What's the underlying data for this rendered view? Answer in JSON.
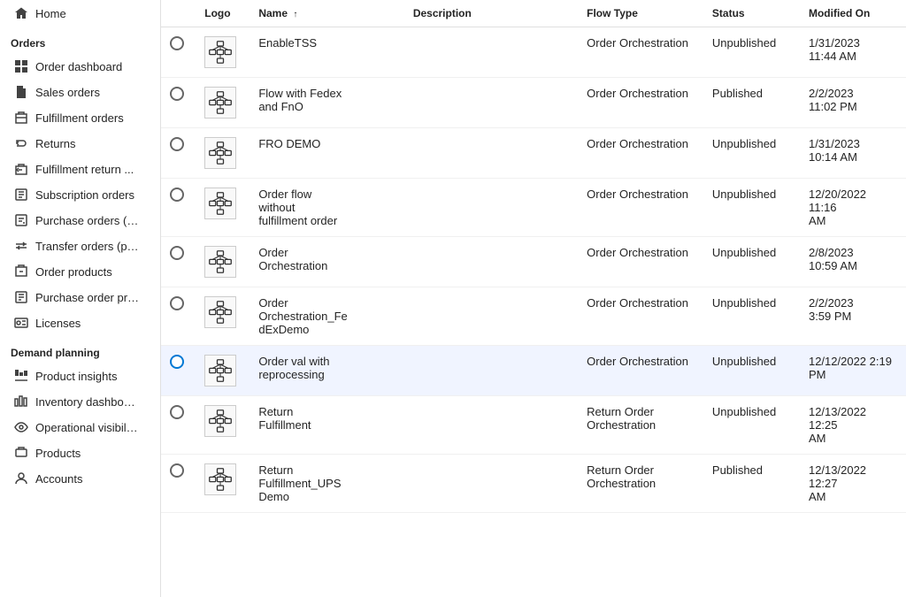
{
  "sidebar": {
    "home_label": "Home",
    "sections": [
      {
        "id": "orders",
        "header": "Orders",
        "items": [
          {
            "id": "order-dashboard",
            "label": "Order dashboard",
            "icon": "grid"
          },
          {
            "id": "sales-orders",
            "label": "Sales orders",
            "icon": "doc"
          },
          {
            "id": "fulfillment-orders",
            "label": "Fulfillment orders",
            "icon": "box"
          },
          {
            "id": "returns",
            "label": "Returns",
            "icon": "return"
          },
          {
            "id": "fulfillment-return",
            "label": "Fulfillment return ...",
            "icon": "return-box"
          },
          {
            "id": "subscription-orders",
            "label": "Subscription orders",
            "icon": "sub"
          },
          {
            "id": "purchase-orders",
            "label": "Purchase orders (…",
            "icon": "purchase"
          },
          {
            "id": "transfer-orders",
            "label": "Transfer orders (p…",
            "icon": "transfer"
          },
          {
            "id": "order-products",
            "label": "Order products",
            "icon": "order-prod"
          },
          {
            "id": "purchase-order-pr",
            "label": "Purchase order pr…",
            "icon": "po-pr"
          },
          {
            "id": "licenses",
            "label": "Licenses",
            "icon": "license"
          }
        ]
      },
      {
        "id": "demand-planning",
        "header": "Demand planning",
        "items": [
          {
            "id": "product-insights",
            "label": "Product insights",
            "icon": "chart"
          },
          {
            "id": "inventory-dashbo",
            "label": "Inventory dashbo…",
            "icon": "chart2"
          },
          {
            "id": "operational-visib",
            "label": "Operational visibil…",
            "icon": "eye"
          },
          {
            "id": "products",
            "label": "Products",
            "icon": "product"
          },
          {
            "id": "accounts",
            "label": "Accounts",
            "icon": "account"
          }
        ]
      }
    ]
  },
  "table": {
    "columns": [
      {
        "id": "radio",
        "label": ""
      },
      {
        "id": "logo",
        "label": "Logo"
      },
      {
        "id": "name",
        "label": "Name",
        "sortable": true,
        "sort": "asc"
      },
      {
        "id": "description",
        "label": "Description"
      },
      {
        "id": "flow_type",
        "label": "Flow Type"
      },
      {
        "id": "status",
        "label": "Status"
      },
      {
        "id": "modified_on",
        "label": "Modified On"
      }
    ],
    "rows": [
      {
        "id": 1,
        "name": "EnableTSS",
        "description": "",
        "flow_type": "Order Orchestration",
        "status": "Unpublished",
        "modified_on": "1/31/2023\n11:44 AM",
        "selected": false
      },
      {
        "id": 2,
        "name": "Flow with Fedex\nand FnO",
        "description": "",
        "flow_type": "Order Orchestration",
        "status": "Published",
        "modified_on": "2/2/2023\n11:02 PM",
        "selected": false
      },
      {
        "id": 3,
        "name": "FRO DEMO",
        "description": "",
        "flow_type": "Order Orchestration",
        "status": "Unpublished",
        "modified_on": "1/31/2023\n10:14 AM",
        "selected": false
      },
      {
        "id": 4,
        "name": "Order flow\nwithout\nfulfillment order",
        "description": "",
        "flow_type": "Order Orchestration",
        "status": "Unpublished",
        "modified_on": "12/20/2022 11:16\nAM",
        "selected": false
      },
      {
        "id": 5,
        "name": "Order\nOrchestration",
        "description": "",
        "flow_type": "Order Orchestration",
        "status": "Unpublished",
        "modified_on": "2/8/2023\n10:59 AM",
        "selected": false
      },
      {
        "id": 6,
        "name": "Order\nOrchestration_Fe\ndExDemo",
        "description": "",
        "flow_type": "Order Orchestration",
        "status": "Unpublished",
        "modified_on": "2/2/2023\n3:59 PM",
        "selected": false
      },
      {
        "id": 7,
        "name": "Order val with\nreprocessing",
        "description": "",
        "flow_type": "Order Orchestration",
        "status": "Unpublished",
        "modified_on": "12/12/2022 2:19 PM",
        "selected": true
      },
      {
        "id": 8,
        "name": "Return\nFulfillment",
        "description": "",
        "flow_type": "Return Order Orchestration",
        "status": "Unpublished",
        "modified_on": "12/13/2022 12:25\nAM",
        "selected": false
      },
      {
        "id": 9,
        "name": "Return\nFulfillment_UPS\nDemo",
        "description": "",
        "flow_type": "Return Order Orchestration",
        "status": "Published",
        "modified_on": "12/13/2022 12:27\nAM",
        "selected": false
      }
    ]
  }
}
